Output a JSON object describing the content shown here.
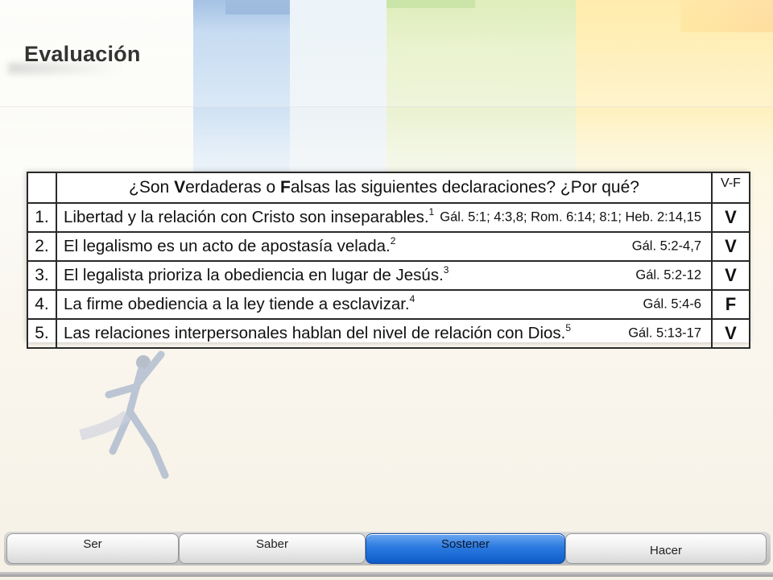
{
  "slide": {
    "title": "Evaluación"
  },
  "table": {
    "header": {
      "question_pre": "¿Son ",
      "question_v": "V",
      "question_mid": "erdaderas o ",
      "question_f": "F",
      "question_post": "alsas las siguientes declaraciones? ¿Por qué?",
      "vf_label": "V-F"
    },
    "rows": [
      {
        "num": "1.",
        "statement": "Libertad y la relación con Cristo son inseparables.",
        "note": "1",
        "reference": "Gál. 5:1; 4:3,8; Rom. 6:14; 8:1; Heb. 2:14,15",
        "answer": "V"
      },
      {
        "num": "2.",
        "statement": "El legalismo es un acto de apostasía velada.",
        "note": "2",
        "reference": "Gál. 5:2-4,7",
        "answer": "V"
      },
      {
        "num": "3.",
        "statement": "El legalista prioriza la obediencia en lugar de Jesús.",
        "note": "3",
        "reference": "Gál. 5:2-12",
        "answer": "V"
      },
      {
        "num": "4.",
        "statement": "La firme obediencia a la ley tiende a esclavizar.",
        "note": "4",
        "reference": "Gál. 5:4-6",
        "answer": "F"
      },
      {
        "num": "5.",
        "statement": "Las relaciones interpersonales hablan del nivel de relación con Dios.",
        "note": "5",
        "reference": "Gál. 5:13-17",
        "answer": "V"
      }
    ]
  },
  "tabs": [
    {
      "label": "Ser",
      "active": false
    },
    {
      "label": "Saber",
      "active": false
    },
    {
      "label": "Sostener",
      "active": true
    },
    {
      "label": "Hacer",
      "active": false
    }
  ],
  "colors": {
    "active_tab": "#2a7ae0",
    "title_text": "#333333",
    "stripe_blue": "#3a78c4",
    "stripe_green": "#b9d86a",
    "stripe_yellow": "#ffd449"
  }
}
